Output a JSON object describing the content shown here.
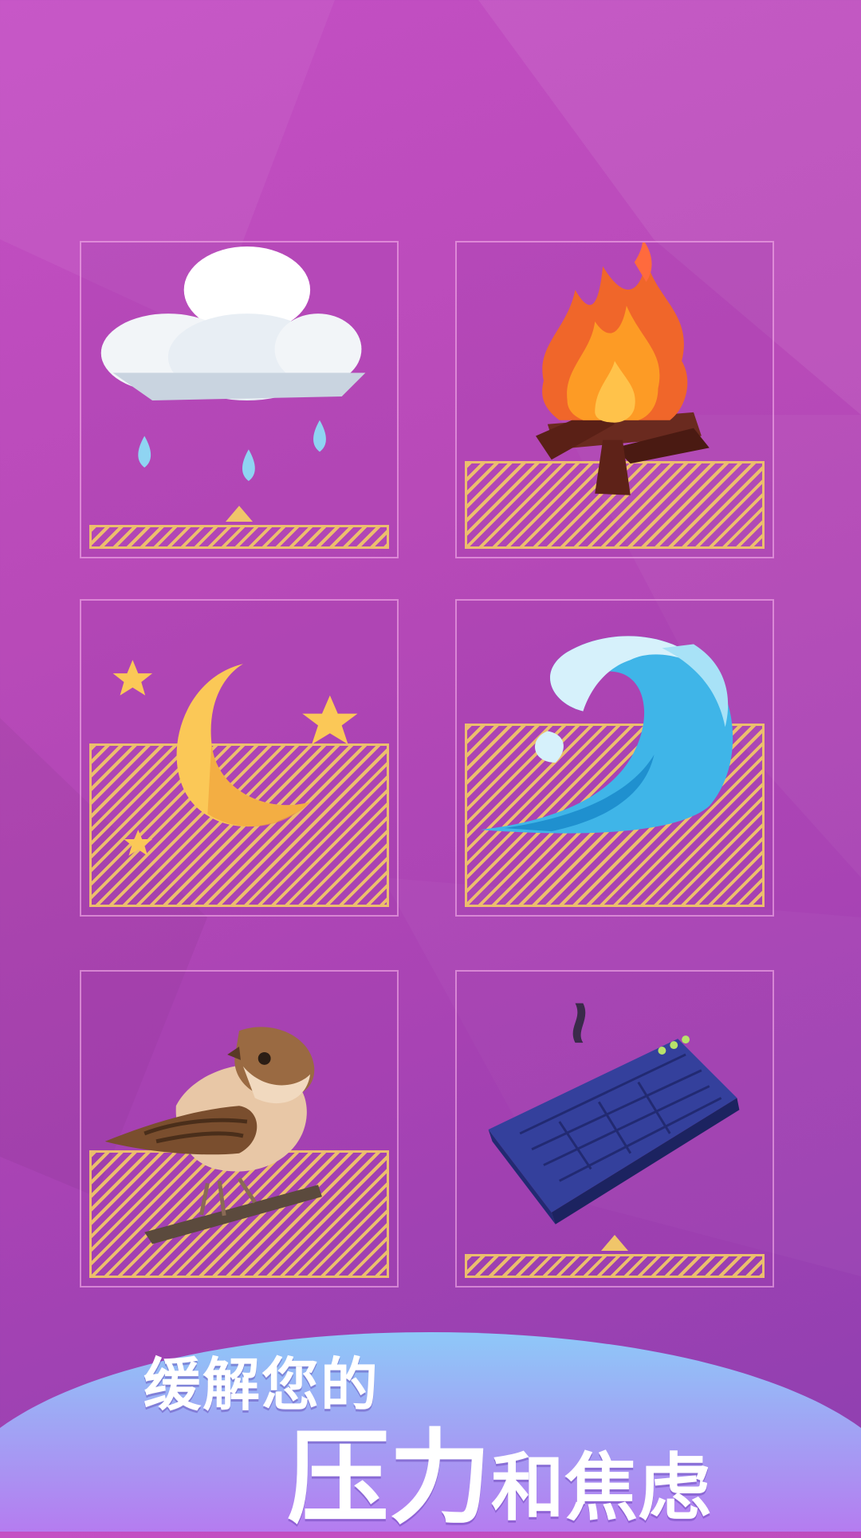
{
  "tiles": [
    {
      "name": "rain",
      "icon": "rain-cloud-icon",
      "level": 0.05
    },
    {
      "name": "fire",
      "icon": "campfire-icon",
      "level": 0.3
    },
    {
      "name": "night",
      "icon": "crescent-moon-stars-icon",
      "level": 0.55
    },
    {
      "name": "ocean",
      "icon": "ocean-wave-icon",
      "level": 0.58
    },
    {
      "name": "bird",
      "icon": "sparrow-bird-icon",
      "level": 0.4
    },
    {
      "name": "keyboard",
      "icon": "keyboard-icon",
      "level": 0.05
    }
  ],
  "caption": {
    "line1": "缓解您的",
    "line2_big": "压力",
    "line2_rest": "和焦虑"
  },
  "colors": {
    "background": "#b84ab8",
    "level_fill": "#f0c56a",
    "banner_top": "#8ec8f8",
    "banner_bottom": "#b57cf0"
  }
}
